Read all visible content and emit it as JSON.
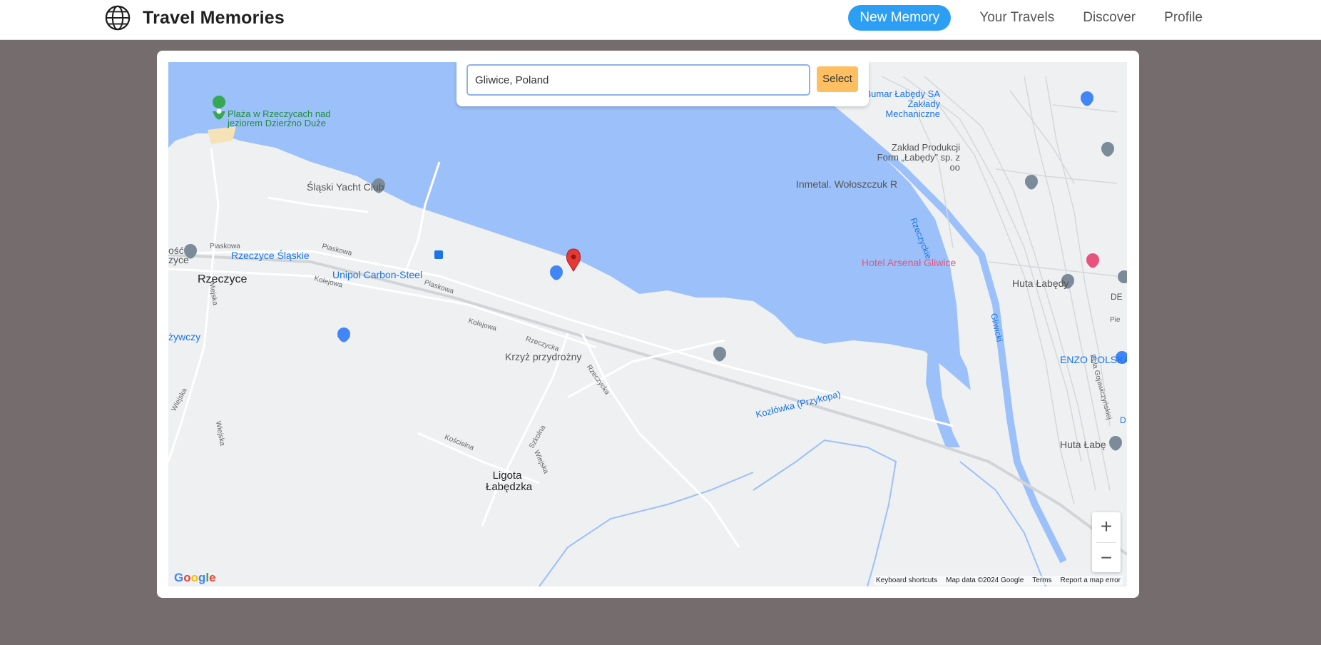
{
  "app": {
    "title": "Travel Memories",
    "logo_icon": "globe-icon"
  },
  "nav": {
    "primary_button": "New Memory",
    "links": [
      "Your Travels",
      "Discover",
      "Profile"
    ],
    "accent": "#2c9ef3"
  },
  "search": {
    "value": "Gliwice, Poland",
    "select_label": "Select",
    "select_color": "#fdbf62"
  },
  "map": {
    "places": {
      "beach": "Plaża w Rzeczycach nad jeziorem Dzierżno Duże",
      "yacht": "Śląski Yacht Club",
      "station": "Rzeczyce Śląskie",
      "unipol": "Unipol Carbon-Steel",
      "town": "Rzeczyce",
      "krzyz": "Krzyż przydrożny",
      "ligota": "Ligota Łabędzka",
      "bumar": "Bumar Łabędy SA Zakłady Mechaniczne",
      "zaklad": "Zakład Produkcji Form „Łabędy” sp. z oo",
      "inmetal": "Inmetal. Wołoszczuk R",
      "hotel": "Hotel Arsenał Gliwice",
      "huta": "Huta Łabędy",
      "huta2": "Huta Łabę",
      "enzo": "ENZO POLSKA",
      "kozlowka": "Kozłówka (Przykopa)",
      "rzeczyckie": "Rzeczyckie",
      "gliwicki": "Gliwicki",
      "zywczy": "żywczy",
      "sosc": "ość",
      "zyce": "zyce",
      "de": "DE",
      "d": "D"
    },
    "roads": {
      "piaskowa": "Piaskowa",
      "kolejowa": "Kolejowa",
      "rzeczycka": "Rzeczycka",
      "wiejska": "Wiejska",
      "koscielna": "Kościelna",
      "szkolna": "Szkolna",
      "pola": "Pola Gojawiczyńskiej",
      "pie": "Pie"
    },
    "zoom_in": "+",
    "zoom_out": "−",
    "google": "Google",
    "attribution": [
      "Keyboard shortcuts",
      "Map data ©2024 Google",
      "Terms",
      "Report a map error"
    ]
  }
}
